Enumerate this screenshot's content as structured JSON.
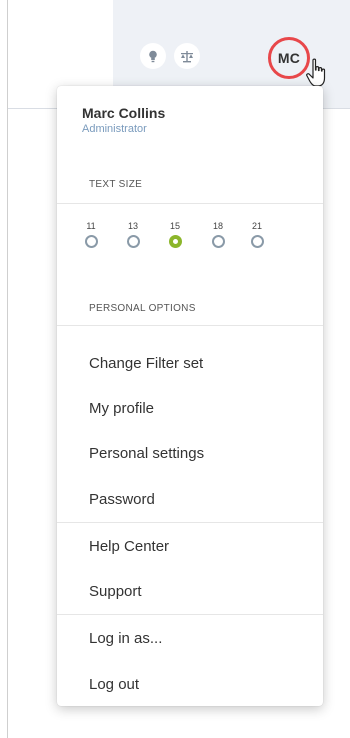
{
  "header": {
    "avatar_initials": "MC",
    "icons": [
      "lightbulb-icon",
      "scale-icon"
    ]
  },
  "menu": {
    "user": {
      "name": "Marc Collins",
      "role": "Administrator"
    },
    "text_size": {
      "label": "TEXT SIZE",
      "options": [
        "11",
        "13",
        "15",
        "18",
        "21"
      ],
      "selected": "15"
    },
    "personal_options": {
      "label": "PERSONAL OPTIONS",
      "items": [
        "Change Filter set",
        "My profile",
        "Personal settings",
        "Password"
      ]
    },
    "help_items": [
      "Help Center",
      "Support"
    ],
    "session_items": [
      "Log in as...",
      "Log out"
    ]
  },
  "colors": {
    "accent_ring": "#e8474a",
    "selected_radio": "#8cb62b",
    "role_text": "#7a9bbd",
    "topbar_bg": "#eef1f6"
  }
}
